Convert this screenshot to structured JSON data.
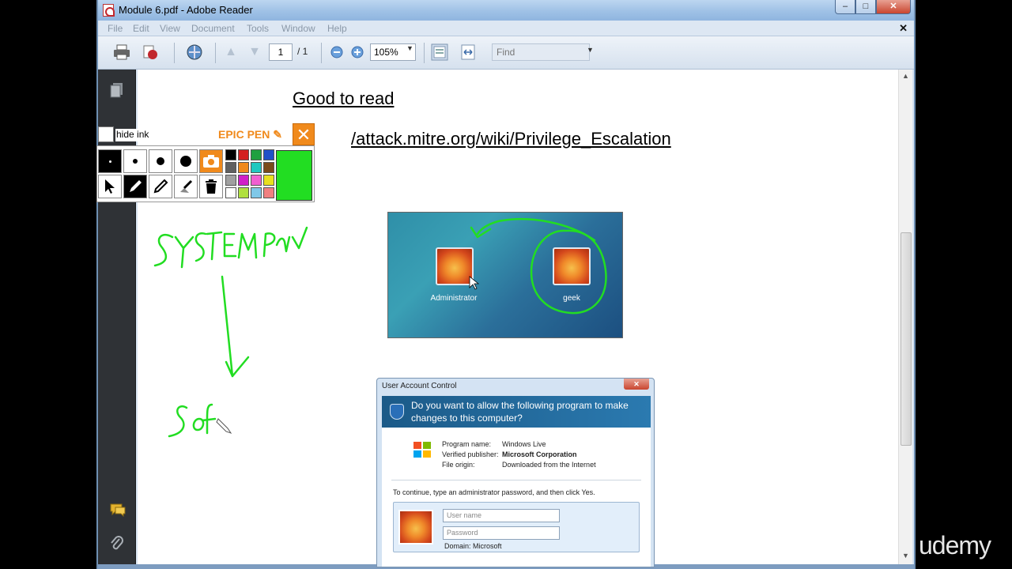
{
  "window": {
    "title": "Module 6.pdf - Adobe Reader",
    "min": "–",
    "max": "□",
    "close": "✕"
  },
  "menu": [
    "File",
    "Edit",
    "View",
    "Document",
    "Tools",
    "Window",
    "Help"
  ],
  "menu_close": "✕",
  "toolbar": {
    "page_current": "1",
    "page_total": "/ 1",
    "zoom": "105%",
    "find_placeholder": "Find"
  },
  "doc": {
    "heading": "Good to read",
    "link": "/attack.mitre.org/wiki/Privilege_Escalation"
  },
  "epic_pen": {
    "hide_label": "hide ink",
    "title": "EPIC PEN ✎",
    "close": "✕",
    "palette": [
      "#000000",
      "#d42020",
      "#20a040",
      "#2050c8",
      "#606060",
      "#f08a1c",
      "#20c8c0",
      "#7a4a1a",
      "#a0a0a0",
      "#d020c8",
      "#f060d0",
      "#e8e020",
      "#ffffff",
      "#b0e040",
      "#80c8e8",
      "#f08080"
    ],
    "active_color": "#22dd22"
  },
  "logon": {
    "user1": "Administrator",
    "user2": "geek"
  },
  "uac": {
    "title": "User Account Control",
    "question": "Do you want to allow the following program to make changes to this computer?",
    "program_label": "Program name:",
    "program_value": "Windows Live",
    "publisher_label": "Verified publisher:",
    "publisher_value": "Microsoft Corporation",
    "origin_label": "File origin:",
    "origin_value": "Downloaded from the Internet",
    "instruction": "To continue, type an administrator password, and then click Yes.",
    "username_placeholder": "User name",
    "password_placeholder": "Password",
    "domain": "Domain: Microsoft"
  },
  "watermark": "udemy"
}
